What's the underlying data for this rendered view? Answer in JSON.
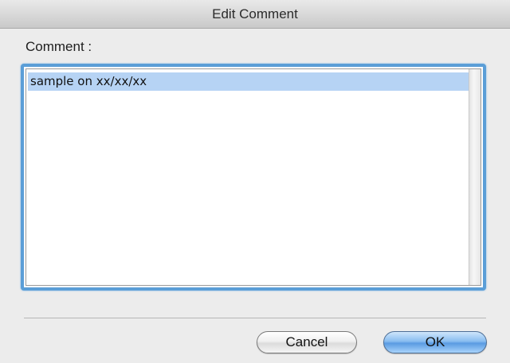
{
  "window": {
    "title": "Edit Comment"
  },
  "form": {
    "comment_label": "Comment :",
    "comment_value": "sample on xx/xx/xx"
  },
  "buttons": {
    "cancel_label": "Cancel",
    "ok_label": "OK"
  },
  "colors": {
    "focus_ring": "#5b9ed7",
    "selection": "#b6d3f4",
    "default_button": "#5a9be2"
  }
}
